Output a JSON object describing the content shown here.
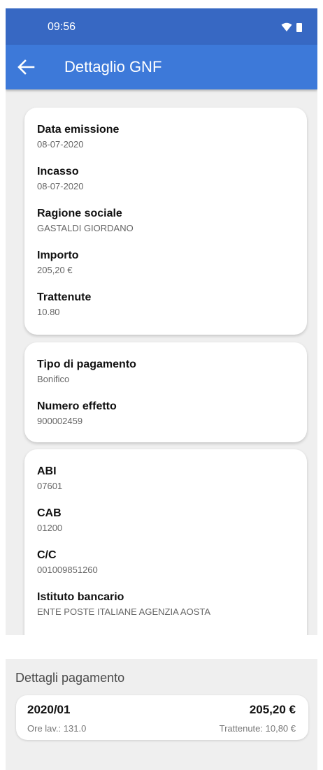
{
  "status_bar": {
    "time": "09:56"
  },
  "app_bar": {
    "title": "Dettaglio GNF"
  },
  "card1": {
    "fields": [
      {
        "label": "Data emissione",
        "value": "08-07-2020"
      },
      {
        "label": "Incasso",
        "value": "08-07-2020"
      },
      {
        "label": "Ragione sociale",
        "value": "GASTALDI GIORDANO"
      },
      {
        "label": "Importo",
        "value": "205,20 €"
      },
      {
        "label": "Trattenute",
        "value": "10.80"
      }
    ]
  },
  "card2": {
    "fields": [
      {
        "label": "Tipo di pagamento",
        "value": "Bonifico"
      },
      {
        "label": "Numero effetto",
        "value": "900002459"
      }
    ]
  },
  "card3": {
    "fields": [
      {
        "label": "ABI",
        "value": "07601"
      },
      {
        "label": "CAB",
        "value": "01200"
      },
      {
        "label": "C/C",
        "value": "001009851260"
      },
      {
        "label": "Istituto bancario",
        "value": "ENTE POSTE ITALIANE AGENZIA AOSTA"
      }
    ]
  },
  "payments": {
    "title": "Dettagli pagamento",
    "items": [
      {
        "period": "2020/01",
        "amount": "205,20 €",
        "hours": "Ore lav.: 131.0",
        "withholding": "Trattenute: 10,80 €"
      }
    ]
  }
}
